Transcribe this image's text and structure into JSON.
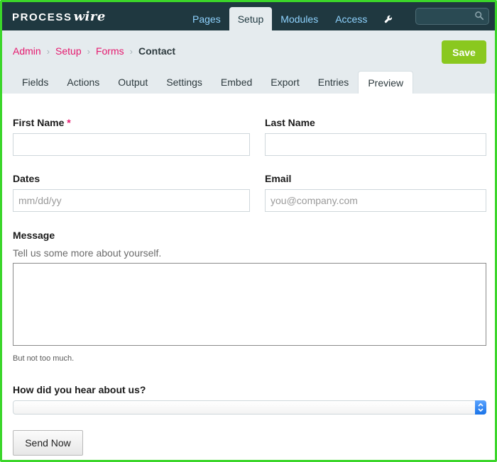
{
  "masthead": {
    "logo_process": "PROCESS",
    "logo_wire": "wire",
    "nav": [
      "Pages",
      "Setup",
      "Modules",
      "Access"
    ],
    "active_nav": "Setup",
    "search_placeholder": ""
  },
  "breadcrumb": {
    "items": [
      "Admin",
      "Setup",
      "Forms"
    ],
    "current": "Contact"
  },
  "actions": {
    "save_label": "Save"
  },
  "tabs": {
    "items": [
      "Fields",
      "Actions",
      "Output",
      "Settings",
      "Embed",
      "Export",
      "Entries",
      "Preview"
    ],
    "active": "Preview"
  },
  "form": {
    "first_name": {
      "label": "First Name",
      "required_mark": "*",
      "value": "",
      "placeholder": ""
    },
    "last_name": {
      "label": "Last Name",
      "value": "",
      "placeholder": ""
    },
    "dates": {
      "label": "Dates",
      "placeholder": "mm/dd/yy"
    },
    "email": {
      "label": "Email",
      "placeholder": "you@company.com"
    },
    "message": {
      "label": "Message",
      "description": "Tell us some more about yourself.",
      "note": "But not too much.",
      "value": ""
    },
    "hear_about": {
      "label": "How did you hear about us?",
      "selected": ""
    },
    "submit_label": "Send Now"
  },
  "colors": {
    "frame_border": "#3bd62a",
    "masthead_bg": "#1f3840",
    "nav_link": "#8fd3ff",
    "breadcrumb_link": "#e5196e",
    "save_button": "#8ac81f",
    "header_bg": "#e5ebee"
  },
  "icons": {
    "nav_tools": "wrench-icon",
    "search": "search-icon",
    "breadcrumb_separator": "chevron-right-icon"
  }
}
